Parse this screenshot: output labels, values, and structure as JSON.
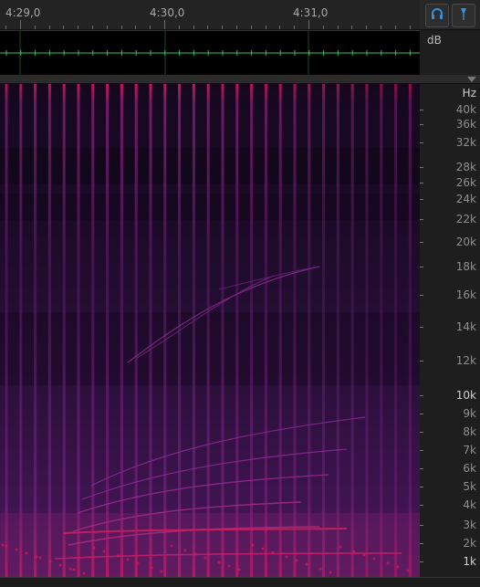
{
  "timeline": {
    "time_labels": [
      "4:29,0",
      "4:30,0",
      "4:31,0"
    ]
  },
  "toolbar": {
    "monitor_icon": "headphones-icon",
    "marker_icon": "marker-pin-icon",
    "accent_color": "#3a8fd8"
  },
  "waveform": {
    "db_label": "dB",
    "line_color": "#3fbf5f"
  },
  "spectrogram": {
    "hz_unit": "Hz",
    "labels": [
      "40k",
      "36k",
      "32k",
      "28k",
      "26k",
      "24k",
      "22k",
      "20k",
      "18k",
      "16k",
      "14k",
      "12k",
      "10k",
      "9k",
      "8k",
      "7k",
      "6k",
      "5k",
      "4k",
      "3k",
      "2k",
      "1k"
    ],
    "colors": {
      "low": "#15081e",
      "mid": "#6a1a6e",
      "high": "#d4145a"
    }
  }
}
